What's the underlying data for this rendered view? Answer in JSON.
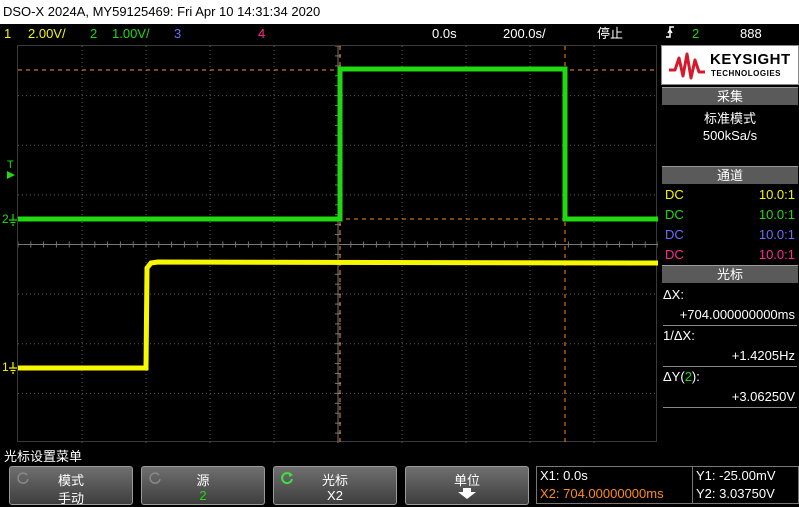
{
  "title": "DSO-X 2024A, MY59125469: Fri Apr 10 14:31:34 2020",
  "status": {
    "ch1_num": "1",
    "ch1_scale": "2.00V/",
    "ch2_num": "2",
    "ch2_scale": "1.00V/",
    "ch3_num": "3",
    "ch4_num": "4",
    "time_pos": "0.0s",
    "time_scale": "200.0s/",
    "run_state": "停止",
    "trig_icon": "trigger-edge-icon",
    "trig_ch": "2",
    "trig_level": "888"
  },
  "colors": {
    "ch1": "#f7f700",
    "ch2": "#22d811",
    "ch3": "#6b6bff",
    "ch4": "#ff2a90",
    "cursor": "#ff8c1a",
    "grid": "#5a5a5a"
  },
  "markers": {
    "ch1": "1",
    "ch2": "2",
    "trig": "T"
  },
  "logo": {
    "brand": "KEYSIGHT",
    "sub": "TECHNOLOGIES"
  },
  "acq": {
    "header": "采集",
    "mode": "标准模式",
    "rate": "500kSa/s"
  },
  "channels": {
    "header": "通道",
    "rows": [
      {
        "coupling": "DC",
        "ratio": "10.0:1"
      },
      {
        "coupling": "DC",
        "ratio": "10.0:1"
      },
      {
        "coupling": "DC",
        "ratio": "10.0:1"
      },
      {
        "coupling": "DC",
        "ratio": "10.0:1"
      }
    ]
  },
  "cursors": {
    "header": "光标",
    "dx_label": "ΔX:",
    "dx_value": "+704.000000000ms",
    "inv_dx_label": "1/ΔX:",
    "inv_dx_value": "+1.4205Hz",
    "dy_label_pre": "ΔY(",
    "dy_label_ch": "2",
    "dy_label_post": "):",
    "dy_value": "+3.06250V"
  },
  "menu": {
    "title": "光标设置菜单",
    "keys": [
      {
        "label": "模式",
        "value": "手动"
      },
      {
        "label": "源",
        "value": "2"
      },
      {
        "label": "光标",
        "value": "X2"
      },
      {
        "label": "单位",
        "value": ""
      }
    ]
  },
  "readout_x": {
    "x1": "X1: 0.0s",
    "x2": "X2: 704.00000000ms"
  },
  "readout_y": {
    "y1": "Y1: -25.00mV",
    "y2": "Y2: 3.03750V"
  }
}
